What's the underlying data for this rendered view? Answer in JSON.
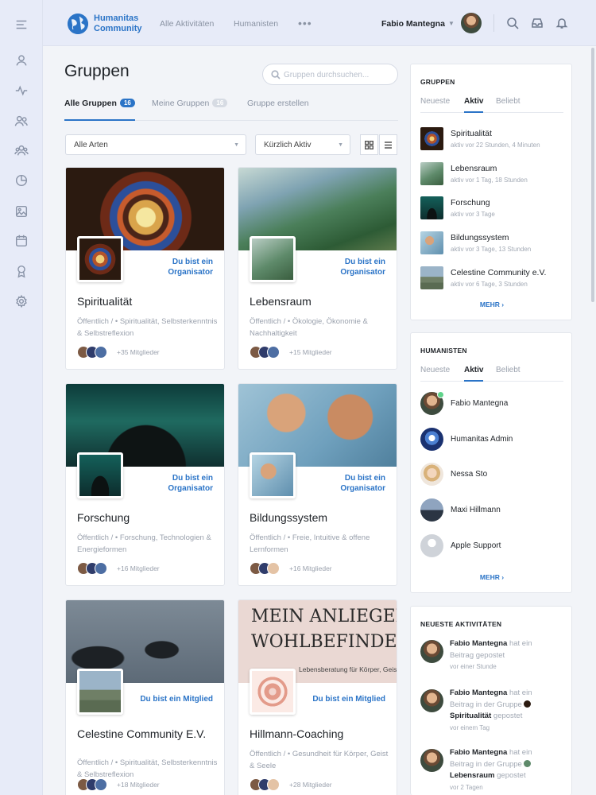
{
  "brand": {
    "line1": "Humanitas",
    "line2": "Community"
  },
  "topnav": [
    "Alle Aktivitäten",
    "Humanisten"
  ],
  "header": {
    "user_name": "Fabio Mantegna"
  },
  "sidebar": [
    "menu-toggle-icon",
    "profile-icon",
    "activity-icon",
    "friends-icon",
    "groups-icon",
    "analytics-icon",
    "photos-icon",
    "calendar-icon",
    "achievements-icon",
    "settings-icon"
  ],
  "page": {
    "title": "Gruppen",
    "search_placeholder": "Gruppen durchsuchen...",
    "tabs": [
      {
        "label": "Alle Gruppen",
        "count": "16"
      },
      {
        "label": "Meine Gruppen",
        "count": "16"
      },
      {
        "label": "Gruppe erstellen"
      }
    ],
    "filter_type": "Alle Arten",
    "filter_sort": "Kürzlich Aktiv"
  },
  "groups": [
    {
      "name": "Spiritualität",
      "role": "Du bist ein Organisator",
      "desc": "Öffentlich / • Spiritualität, Selbsterkenntnis & Selbstreflexion",
      "members": "+35 Mitglieder"
    },
    {
      "name": "Lebensraum",
      "role": "Du bist ein Organisator",
      "desc": "Öffentlich / • Ökologie, Ökonomie & Nachhaltigkeit",
      "members": "+15 Mitglieder"
    },
    {
      "name": "Forschung",
      "role": "Du bist ein Organisator",
      "desc": "Öffentlich / • Forschung, Technologien & Energieformen",
      "members": "+16 Mitglieder"
    },
    {
      "name": "Bildungssystem",
      "role": "Du bist ein Organisator",
      "desc": "Öffentlich / • Freie, Intuitive & offene Lernformen",
      "members": "+16 Mitglieder"
    },
    {
      "name": "Celestine Community E.V.",
      "role": "Du bist ein Mitglied",
      "desc": "Öffentlich / • Spiritualität, Selbsterkenntnis & Selbstreflexion",
      "members": "+18 Mitglieder"
    },
    {
      "name": "Hillmann-Coaching",
      "role": "Du bist ein Mitglied",
      "desc": "Öffentlich / • Gesundheit für Körper, Geist & Seele",
      "members": "+28 Mitglieder",
      "cover_line1": "MEIN ANLIEGEN",
      "cover_line2": "WOHLBEFINDEN",
      "cover_line3": "Lebensberatung für Körper, Geist"
    }
  ],
  "widget_groups": {
    "title": "GRUPPEN",
    "tabs": [
      "Neueste",
      "Aktiv",
      "Beliebt"
    ],
    "items": [
      {
        "name": "Spiritualität",
        "meta": "aktiv vor 22 Stunden, 4 Minuten"
      },
      {
        "name": "Lebensraum",
        "meta": "aktiv vor 1 Tag, 18 Stunden"
      },
      {
        "name": "Forschung",
        "meta": "aktiv vor 3 Tage"
      },
      {
        "name": "Bildungssystem",
        "meta": "aktiv vor 3 Tage, 13 Stunden"
      },
      {
        "name": "Celestine Community e.V.",
        "meta": "aktiv vor 6 Tage, 3 Stunden"
      }
    ],
    "more": "MEHR"
  },
  "widget_people": {
    "title": "HUMANISTEN",
    "tabs": [
      "Neueste",
      "Aktiv",
      "Beliebt"
    ],
    "items": [
      "Fabio Mantegna",
      "Humanitas Admin",
      "Nessa Sto",
      "Maxi Hillmann",
      "Apple Support"
    ],
    "more": "MEHR"
  },
  "widget_activity": {
    "title": "NEUESTE AKTIVITÄTEN",
    "items": [
      {
        "user": "Fabio Mantegna",
        "t1": "hat ein",
        "t2": "Beitrag gepostet",
        "group": "",
        "t3": "",
        "time": "vor einer Stunde"
      },
      {
        "user": "Fabio Mantegna",
        "t1": "hat ein",
        "t2": "Beitrag in der Gruppe",
        "group": "Spiritualität",
        "t3": "gepostet",
        "time": "vor einem Tag"
      },
      {
        "user": "Fabio Mantegna",
        "t1": "hat ein",
        "t2": "Beitrag in der Gruppe",
        "group": "Lebensraum",
        "t3": "gepostet",
        "time": "vor 2 Tagen"
      }
    ]
  }
}
